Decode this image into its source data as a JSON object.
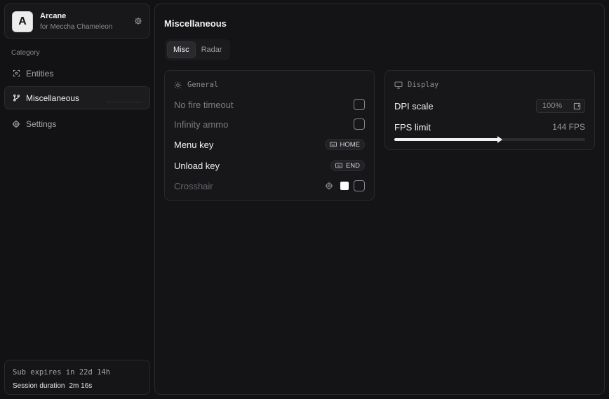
{
  "profile": {
    "avatar_letter": "A",
    "app_name": "Arcane",
    "subtitle": "for Meccha Chameleon",
    "settings_icon": "gear-icon"
  },
  "sidebar": {
    "category_label": "Category",
    "items": [
      {
        "label": "Entities",
        "icon": "entities-icon",
        "active": false
      },
      {
        "label": "Miscellaneous",
        "icon": "misc-icon",
        "active": true
      },
      {
        "label": "Settings",
        "icon": "gear-icon",
        "active": false
      }
    ]
  },
  "footer": {
    "expires": "Sub expires in 22d 14h",
    "session_label": "Session duration",
    "session_value": "2m 16s"
  },
  "main": {
    "title": "Miscellaneous",
    "tabs": [
      {
        "label": "Misc",
        "active": true
      },
      {
        "label": "Radar",
        "active": false
      }
    ],
    "general": {
      "header": "General",
      "no_fire_timeout": {
        "label": "No fire timeout",
        "checked": false
      },
      "infinity_ammo": {
        "label": "Infinity ammo",
        "checked": false
      },
      "menu_key": {
        "label": "Menu key",
        "key": "HOME"
      },
      "unload_key": {
        "label": "Unload key",
        "key": "END"
      },
      "crosshair": {
        "label": "Crosshair",
        "color": "#ffffff",
        "checked": false
      }
    },
    "display": {
      "header": "Display",
      "dpi_scale": {
        "label": "DPI scale",
        "value": "100%"
      },
      "fps_limit": {
        "label": "FPS limit",
        "value_text": "144 FPS",
        "fraction": 0.55
      }
    }
  },
  "colors": {
    "background": "#121214",
    "panel": "#17171a",
    "accent": "#f2f2f4"
  }
}
